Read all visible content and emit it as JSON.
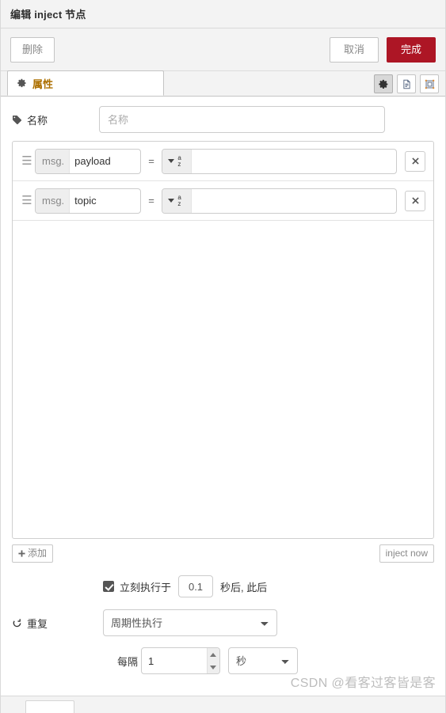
{
  "window": {
    "title": "编辑 inject 节点"
  },
  "toolbar": {
    "delete_label": "删除",
    "cancel_label": "取消",
    "done_label": "完成"
  },
  "tabs": {
    "active": "属性",
    "items": [
      {
        "label": "属性",
        "icon": "gear-icon"
      }
    ],
    "icon_buttons": [
      {
        "name": "properties-icon",
        "active": true
      },
      {
        "name": "description-icon",
        "active": false
      },
      {
        "name": "appearance-icon",
        "active": false
      }
    ]
  },
  "name_field": {
    "label": "名称",
    "icon": "tag-icon",
    "value": "",
    "placeholder": "名称"
  },
  "properties": {
    "rows": [
      {
        "handle": "drag-handle-icon",
        "prefix": "msg.",
        "property": "payload",
        "equals": "=",
        "type_icon": "az-string-icon",
        "value": "",
        "delete_icon": "close-icon"
      },
      {
        "handle": "drag-handle-icon",
        "prefix": "msg.",
        "property": "topic",
        "equals": "=",
        "type_icon": "az-string-icon",
        "value": "",
        "delete_icon": "close-icon"
      }
    ],
    "add_label": "添加",
    "add_icon": "plus-icon",
    "inject_now_label": "inject now"
  },
  "inject_options": {
    "immediate_checked": true,
    "immediate_label": "立刻执行于",
    "delay_value": "0.1",
    "delay_suffix": "秒后, 此后",
    "repeat_label": "重复",
    "repeat_icon": "repeat-icon",
    "repeat_value": "周期性执行",
    "repeat_options": [
      "周期性执行"
    ],
    "interval_label": "每隔",
    "interval_value": "1",
    "unit_value": "秒",
    "unit_options": [
      "秒"
    ]
  },
  "watermark": {
    "text": "CSDN @看客过客皆是客"
  },
  "colors": {
    "primary_red": "#ad1625",
    "tab_active_text": "#ad7000",
    "chrome_bg": "#f3f3f3",
    "border": "#c4c4c4"
  }
}
